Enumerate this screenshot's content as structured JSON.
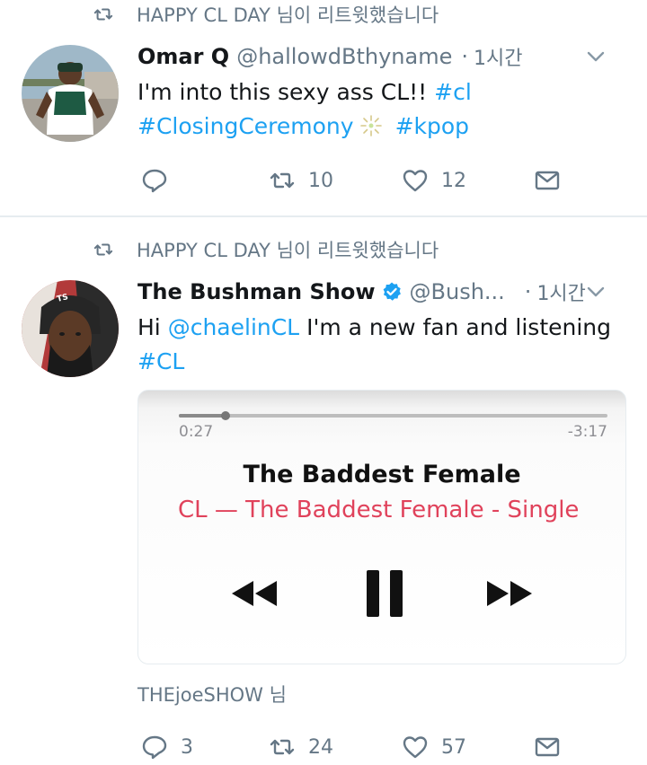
{
  "tweets": [
    {
      "retweeted_by": "HAPPY CL DAY 님이 리트윗했습니다",
      "author_name": "Omar Q",
      "handle": "@hallowdBthyname",
      "time": "1시간",
      "text_plain": "I'm into this sexy ass CL!! ",
      "hashtag_1": "#cl",
      "hashtag_2": "#ClosingCeremony",
      "hashtag_3": "#kpop",
      "retweets": "10",
      "likes": "12"
    },
    {
      "retweeted_by": "HAPPY CL DAY 님이 리트윗했습니다",
      "author_name": "The Bushman Show",
      "handle": "@Bush...",
      "time": "1시간",
      "text_before": "Hi ",
      "mention": "@chaelinCL",
      "text_after": " I'm a new fan and listening",
      "hashtag_1": "#CL",
      "media": {
        "elapsed": "0:27",
        "remaining": "-3:17",
        "progress": 0.11,
        "song_title": "The Baddest Female",
        "artist_album": "CL — The Baddest Female - Single"
      }
    }
  ],
  "next_tweet": {
    "author_preview": "THEjoeSHOW 님",
    "replies": "3",
    "retweets": "24",
    "likes": "57"
  },
  "colors": {
    "link": "#1da1f2",
    "muted": "#657786",
    "music_accent": "#e0425b"
  }
}
